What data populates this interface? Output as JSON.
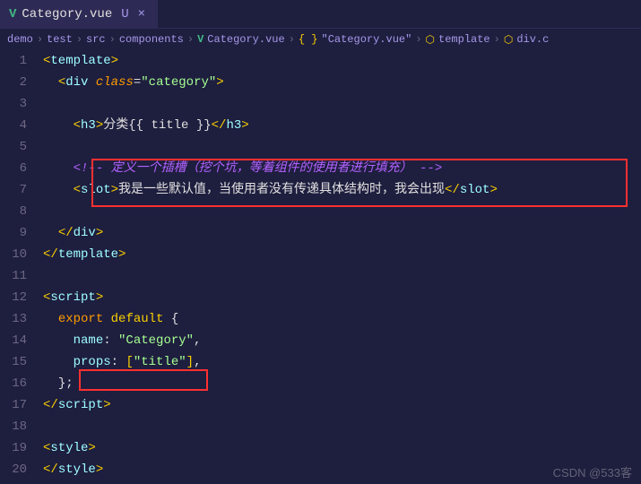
{
  "tab": {
    "filename": "Category.vue",
    "modified_marker": "U",
    "close_glyph": "×"
  },
  "breadcrumb": {
    "items": [
      "demo",
      "test",
      "src",
      "components",
      "Category.vue",
      "\"Category.vue\"",
      "template",
      "div.c"
    ],
    "sep": "›"
  },
  "lines": {
    "count": 20
  },
  "code": {
    "l1_open": "<",
    "l1_tag": "template",
    "l1_close": ">",
    "l2_open": "<",
    "l2_tag": "div",
    "l2_attr": "class",
    "l2_eq": "=",
    "l2_val": "\"category\"",
    "l2_close": ">",
    "l4_open": "<",
    "l4_tag": "h3",
    "l4_close": ">",
    "l4_text": "分类{{ title }}",
    "l4_copen": "</",
    "l4_cclose": ">",
    "l6_comment": "<!-- 定义一个插槽（挖个坑，等着组件的使用者进行填充） -->",
    "l7_open": "<",
    "l7_tag": "slot",
    "l7_close": ">",
    "l7_text": "我是一些默认值，当使用者没有传递具体结构时，我会出现",
    "l7_copen": "</",
    "l7_cclose": ">",
    "l9_open": "</",
    "l9_tag": "div",
    "l9_close": ">",
    "l10_open": "</",
    "l10_tag": "template",
    "l10_close": ">",
    "l12_open": "<",
    "l12_tag": "script",
    "l12_close": ">",
    "l13_export": "export",
    "l13_default": "default",
    "l13_brace": " {",
    "l14_key": "name",
    "l14_colon": ": ",
    "l14_val": "\"Category\"",
    "l14_comma": ",",
    "l15_key": "props",
    "l15_colon": ": ",
    "l15_b1": "[",
    "l15_val": "\"title\"",
    "l15_b2": "]",
    "l15_comma": ",",
    "l16_brace": "}",
    "l16_semi": ";",
    "l17_open": "</",
    "l17_tag": "script",
    "l17_close": ">",
    "l19_open": "<",
    "l19_tag": "style",
    "l19_close": ">",
    "l20_open": "</",
    "l20_tag": "style",
    "l20_close": ">"
  },
  "watermark": "CSDN @533客"
}
